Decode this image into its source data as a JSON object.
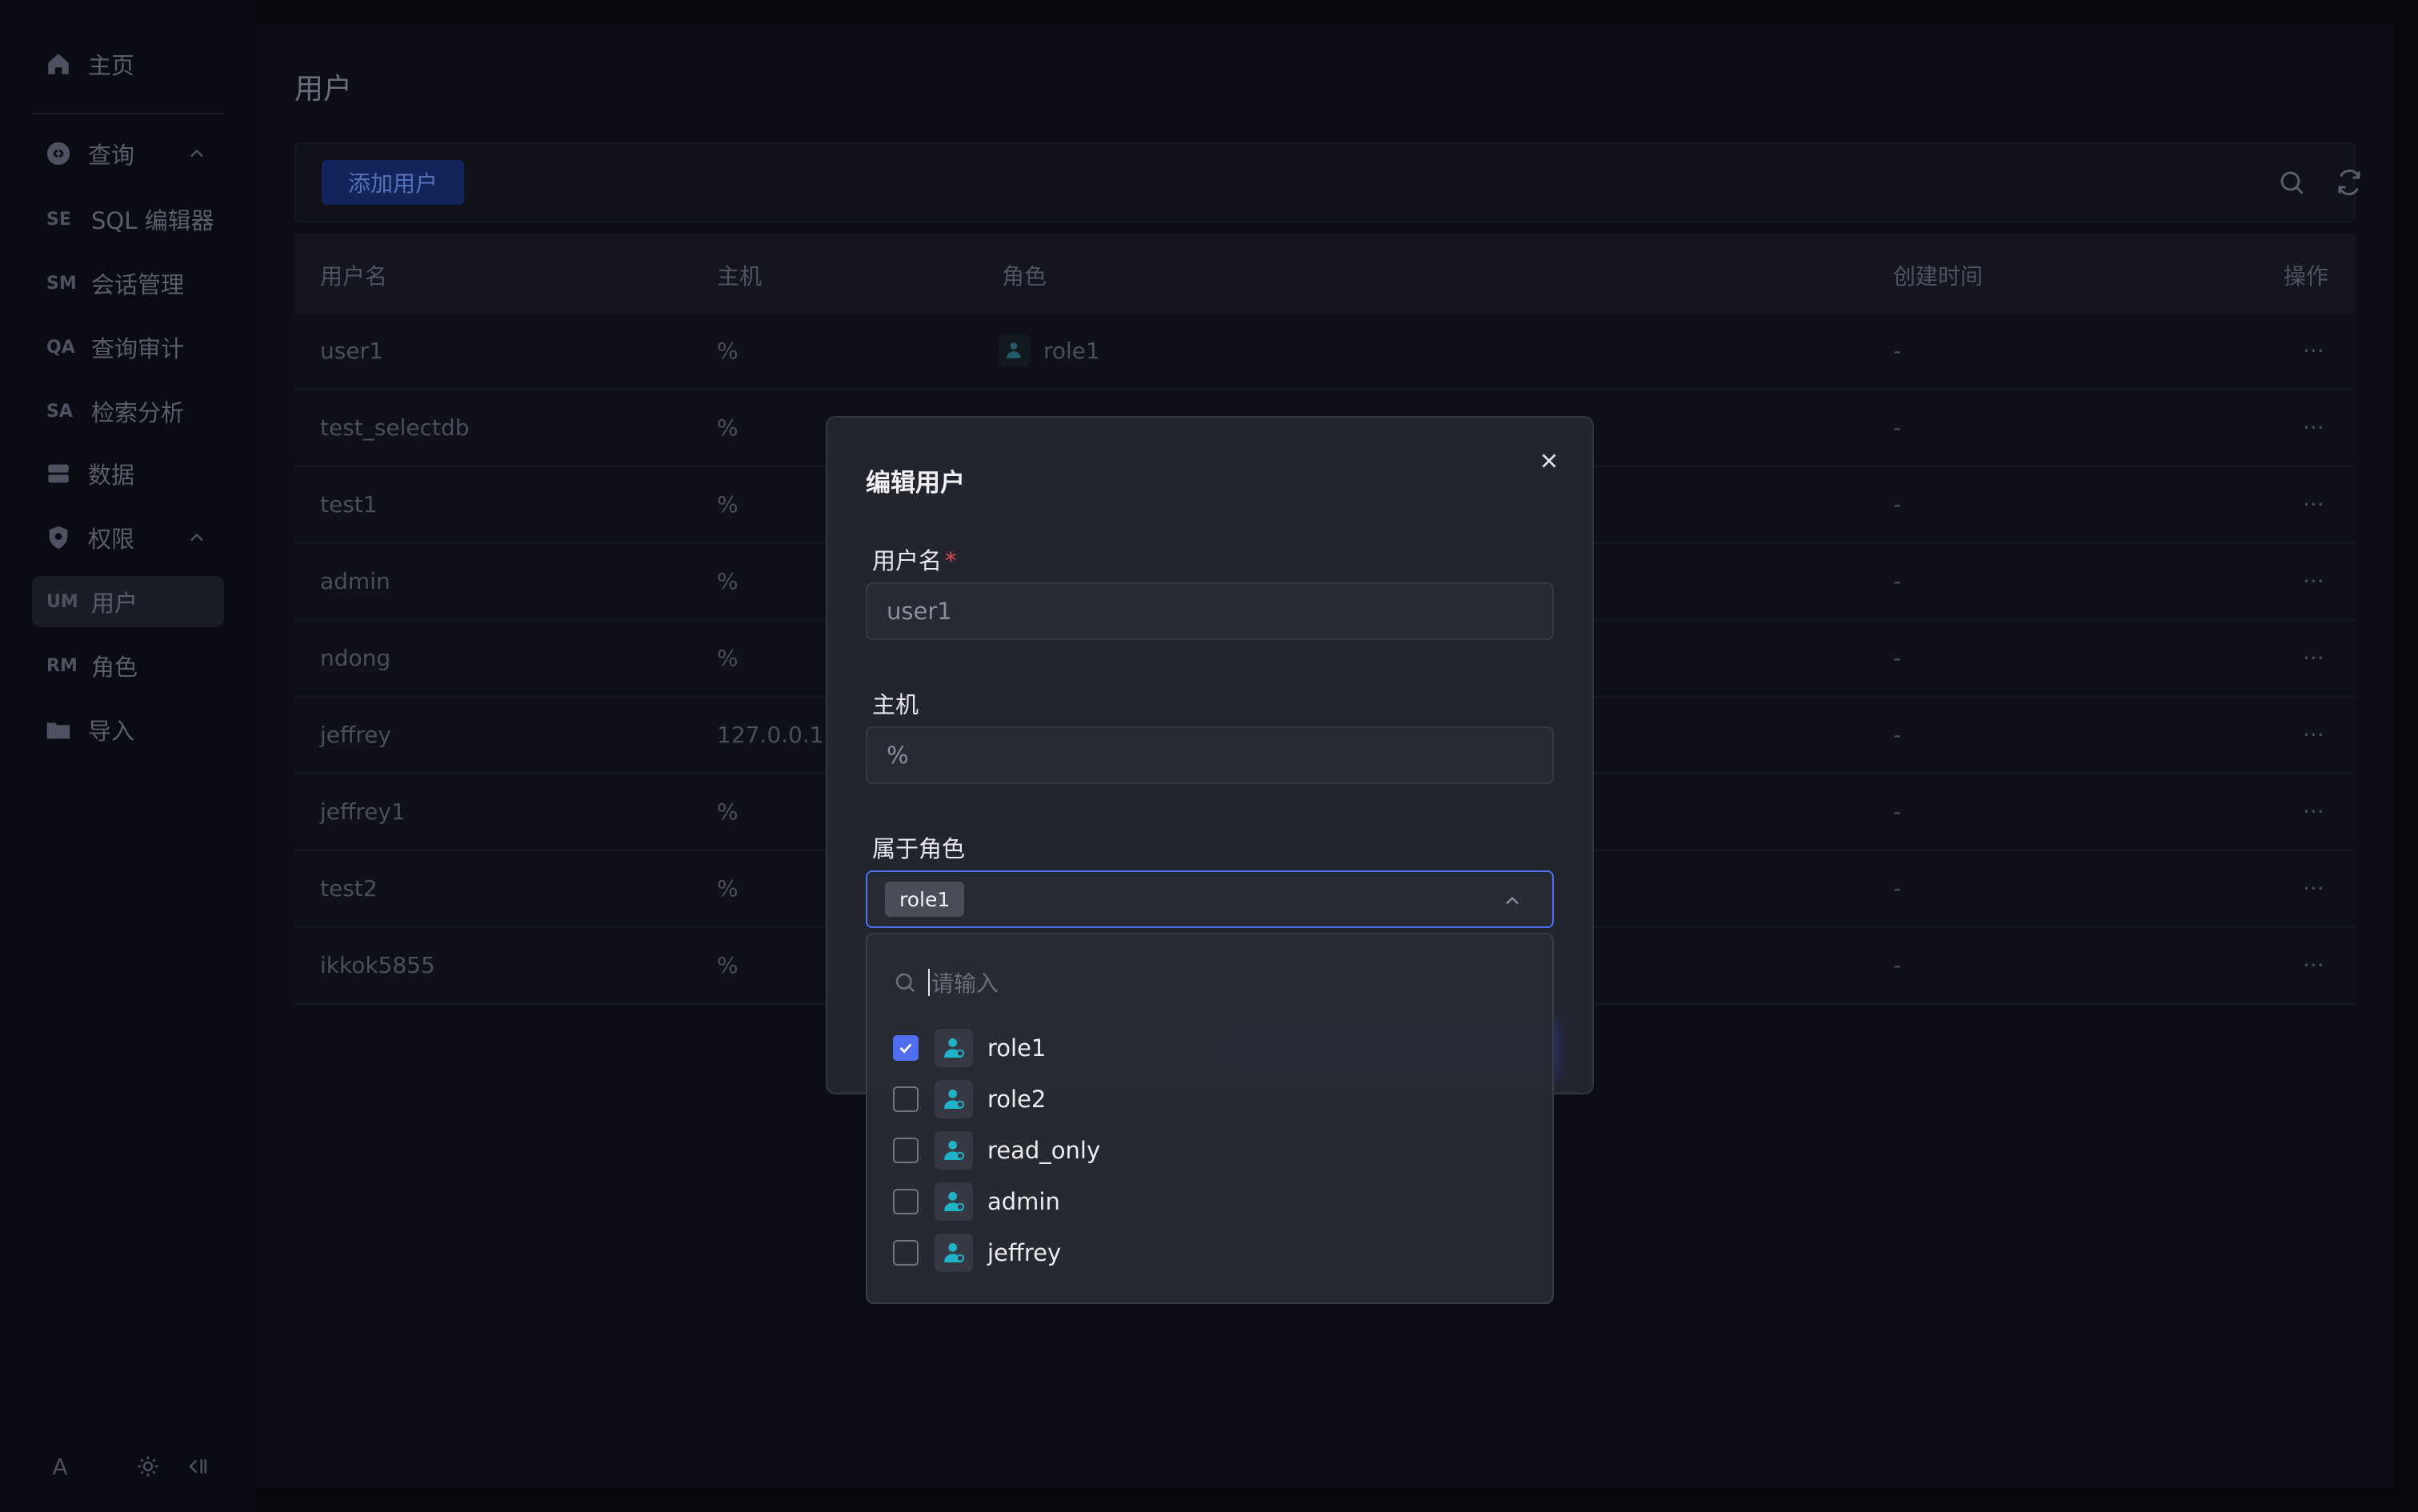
{
  "sidebar": {
    "home": "主页",
    "query": "查询",
    "query_items": [
      {
        "abbr": "SE",
        "label": "SQL 编辑器"
      },
      {
        "abbr": "SM",
        "label": "会话管理"
      },
      {
        "abbr": "QA",
        "label": "查询审计"
      },
      {
        "abbr": "SA",
        "label": "检索分析"
      }
    ],
    "data": "数据",
    "permissions": "权限",
    "perm_items": [
      {
        "abbr": "UM",
        "label": "用户"
      },
      {
        "abbr": "RM",
        "label": "角色"
      }
    ],
    "import": "导入",
    "avatar": "A"
  },
  "page": {
    "title": "用户",
    "add_button": "添加用户"
  },
  "table": {
    "headers": [
      "用户名",
      "主机",
      "角色",
      "创建时间",
      "操作"
    ],
    "rows": [
      {
        "username": "user1",
        "host": "%",
        "role": "role1",
        "created": "-",
        "action": "···"
      },
      {
        "username": "test_selectdb",
        "host": "%",
        "role": "",
        "created": "-",
        "action": "···"
      },
      {
        "username": "test1",
        "host": "%",
        "role": "",
        "created": "-",
        "action": "···"
      },
      {
        "username": "admin",
        "host": "%",
        "role": "",
        "created": "-",
        "action": "···"
      },
      {
        "username": "ndong",
        "host": "%",
        "role": "",
        "created": "-",
        "action": "···"
      },
      {
        "username": "jeffrey",
        "host": "127.0.0.1",
        "role": "",
        "created": "-",
        "action": "···"
      },
      {
        "username": "jeffrey1",
        "host": "%",
        "role": "",
        "created": "-",
        "action": "···"
      },
      {
        "username": "test2",
        "host": "%",
        "role": "",
        "created": "-",
        "action": "···"
      },
      {
        "username": "ikkok5855",
        "host": "%",
        "role": "",
        "created": "-",
        "action": "···"
      }
    ]
  },
  "modal": {
    "title": "编辑用户",
    "username_label": "用户名",
    "username_required": "*",
    "username_value": "user1",
    "host_label": "主机",
    "host_value": "%",
    "roles_label": "属于角色",
    "selected_role": "role1"
  },
  "dropdown": {
    "search_placeholder": "请输入",
    "items": [
      {
        "label": "role1",
        "checked": true
      },
      {
        "label": "role2",
        "checked": false
      },
      {
        "label": "read_only",
        "checked": false
      },
      {
        "label": "admin",
        "checked": false
      },
      {
        "label": "jeffrey",
        "checked": false
      }
    ]
  },
  "colors": {
    "accent": "#4f6ff0",
    "role_icon": "#1fb3c7",
    "required": "#e5484d"
  }
}
